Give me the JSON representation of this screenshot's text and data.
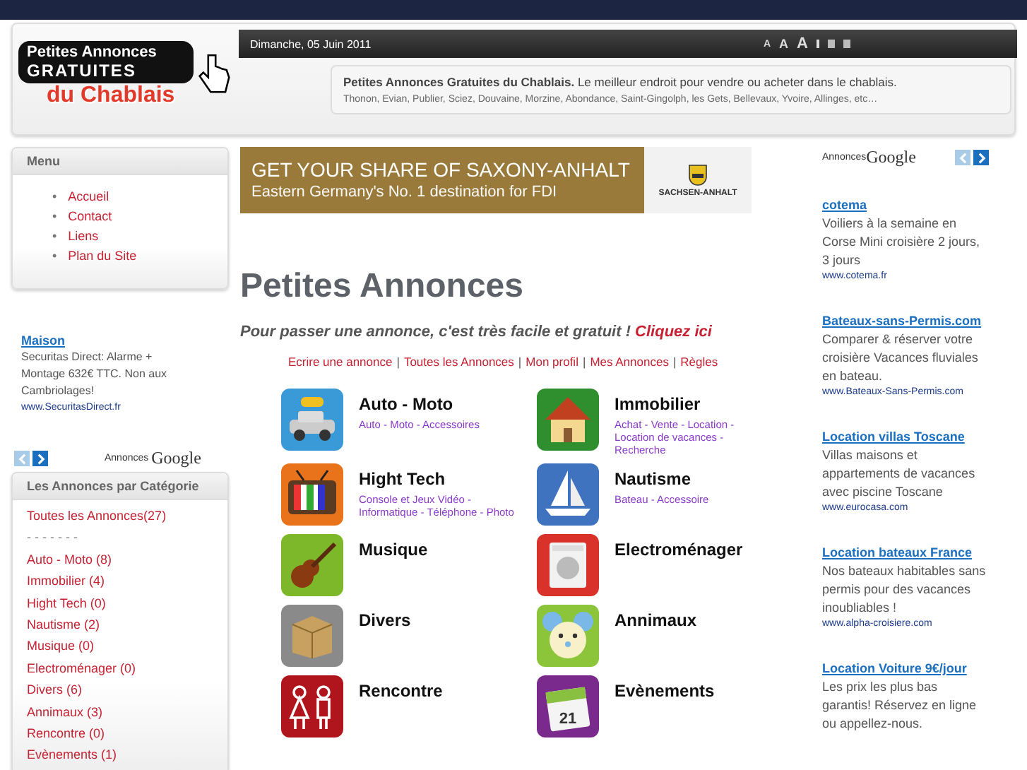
{
  "header": {
    "logo": {
      "line1": "Petites Annonces",
      "line2": "GRATUITES",
      "line3": "du Chablais"
    },
    "date": "Dimanche, 05 Juin 2011",
    "text_size_controls": [
      "A",
      "A",
      "A"
    ],
    "tagline": "**Petites Annonces Gratuites du Chablais.** Le meilleur endroit pour vendre ou acheter dans le chablais.",
    "towns": "Thonon, Evian, Publier, Sciez, Douvaine, Morzine, Abondance, Saint-Gingolph, les Gets, Bellevaux, Yvoire, Allinges, etc…"
  },
  "left": {
    "menu": {
      "title": "Menu",
      "bullet": "•",
      "items": [
        "Accueil",
        "Contact",
        "Liens",
        "Plan du Site"
      ]
    },
    "ad": {
      "title": "Maison",
      "text": "Securitas Direct: Alarme + Montage 632€ TTC. Non aux Cambriolages!",
      "url": "www.SecuritasDirect.fr"
    },
    "ad_nav": [
      {
        "kind": "prev",
        "disabled": true
      },
      {
        "kind": "next",
        "disabled": false
      }
    ],
    "ads_label": "Annonces",
    "ads_brand": "Google",
    "categories": {
      "title": "Les Annonces par Catégorie",
      "items": [
        {
          "kind": "link",
          "label": "Toutes les Annonces(27)"
        },
        {
          "kind": "divider",
          "label": "- - - - - - -"
        },
        {
          "kind": "link",
          "label": "Auto - Moto (8)"
        },
        {
          "kind": "link",
          "label": "Immobilier (4)"
        },
        {
          "kind": "link",
          "label": "Hight Tech (0)"
        },
        {
          "kind": "link",
          "label": "Nautisme (2)"
        },
        {
          "kind": "link",
          "label": "Musique (0)"
        },
        {
          "kind": "link",
          "label": "Electroménager (0)"
        },
        {
          "kind": "link",
          "label": "Divers (6)"
        },
        {
          "kind": "link",
          "label": "Annimaux (3)"
        },
        {
          "kind": "link",
          "label": "Rencontre (0)"
        },
        {
          "kind": "link",
          "label": "Evènements (1)"
        }
      ]
    }
  },
  "main": {
    "banner": {
      "headline": "GET YOUR SHARE OF SAXONY-ANHALT",
      "subline": "Eastern Germany's No. 1 destination for FDI",
      "brand": "SACHSEN-ANHALT"
    },
    "title": "Petites Annonces",
    "intro": "Pour passer une annonce, c'est très facile et gratuit !",
    "intro_link": "Cliquez ici",
    "links": [
      "Ecrire une annonce",
      "Toutes les Annonces",
      "Mon profil",
      "Mes Annonces",
      "Règles"
    ],
    "link_separator": "|",
    "categories": [
      {
        "name": "Auto - Moto",
        "sub": "Auto - Moto - Accessoires",
        "kind": "car",
        "color": "#3a9ad8"
      },
      {
        "name": "Immobilier",
        "sub": "Achat - Vente - Location - Location de vacances - Recherche",
        "kind": "house",
        "color": "#2f8f2f"
      },
      {
        "name": "Hight Tech",
        "sub": "Console et Jeux Vidéo - Informatique - Téléphone - Photo",
        "kind": "tv",
        "color": "#e8731a"
      },
      {
        "name": "Nautisme",
        "sub": "Bateau - Accessoire",
        "kind": "sailboat",
        "color": "#3f73c0"
      },
      {
        "name": "Musique",
        "kind": "guitar",
        "color": "#7cb82a"
      },
      {
        "name": "Electroménager",
        "kind": "washer",
        "color": "#d8322a"
      },
      {
        "name": "Divers",
        "kind": "box",
        "color": "#8a8a8a"
      },
      {
        "name": "Annimaux",
        "kind": "mouse",
        "color": "#8cc43a"
      },
      {
        "name": "Rencontre",
        "kind": "couple",
        "color": "#b0141c"
      },
      {
        "name": "Evènements",
        "kind": "calendar",
        "color": "#7a2a8c",
        "badge": "21"
      }
    ]
  },
  "right": {
    "ads_label": "Annonces",
    "ads_brand": "Google",
    "ad_nav": [
      {
        "kind": "prev",
        "disabled": true
      },
      {
        "kind": "next",
        "disabled": false
      }
    ],
    "ads": [
      {
        "title": "cotema",
        "text": "Voiliers à la semaine en Corse Mini croisière 2 jours, 3 jours",
        "url": "www.cotema.fr"
      },
      {
        "title": "Bateaux-sans-Permis.com",
        "text": "Comparer & réserver votre croisière Vacances fluviales en bateau.",
        "url": "www.Bateaux-Sans-Permis.com"
      },
      {
        "title": "Location villas Toscane",
        "text": "Villas maisons et appartements de vacances avec piscine Toscane",
        "url": "www.eurocasa.com"
      },
      {
        "title": "Location bateaux France",
        "text": "Nos bateaux habitables sans permis pour des vacances inoubliables !",
        "url": "www.alpha-croisiere.com"
      },
      {
        "title": "Location Voiture 9€/jour",
        "text": "Les prix les plus bas garantis! Réservez en ligne ou appellez-nous."
      }
    ]
  }
}
